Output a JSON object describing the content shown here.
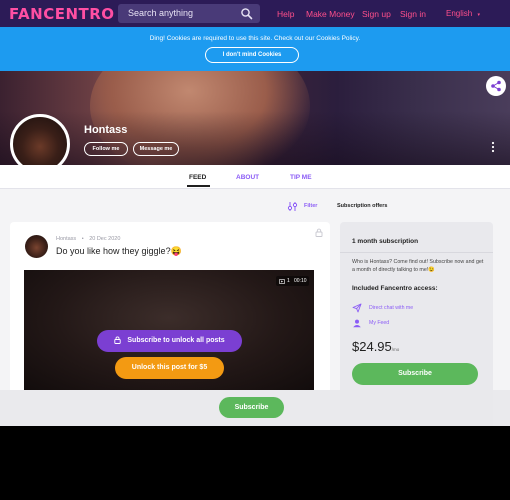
{
  "nav": {
    "logo_text": "FANCENTRO",
    "search_placeholder": "Search anything",
    "links": [
      "Help",
      "Make Money",
      "Sign up",
      "Sign in"
    ],
    "language": "English",
    "colors": {
      "bg": "#2c1b57",
      "link": "#ff4f8b",
      "logo": "#ff4fa3"
    }
  },
  "cookie_bar": {
    "message": "Ding! Cookies are required to use this site. Check out our Cookies Policy.",
    "button_label": "I don't mind Cookies",
    "color": "#1d9bf0"
  },
  "profile": {
    "name": "Hontass",
    "follow_label": "Follow me",
    "message_label": "Message me"
  },
  "tabs": [
    {
      "label": "FEED",
      "active": true
    },
    {
      "label": "ABOUT",
      "active": false
    },
    {
      "label": "TIP ME",
      "active": false
    }
  ],
  "filter": {
    "filter_label": "Filter",
    "subscription_offers_label": "Subscription offers"
  },
  "post": {
    "author": "Hontass",
    "separator": "•",
    "date": "20 Dec 2020",
    "title": "Do you like how they giggle?😝",
    "media_count": "1",
    "media_duration": "00:10",
    "unlock_all_label": "Subscribe to unlock all posts",
    "unlock_post_label": "Unlock this post for $5"
  },
  "subscription": {
    "title": "1 month subscription",
    "description": "Who is Hontass? Come find out! Subscribe now and get a month of directly talking to me!😉",
    "included_title": "Included Fancentro access:",
    "access_items": [
      {
        "icon": "send-icon",
        "label": "Direct chat with me"
      },
      {
        "icon": "feed-icon",
        "label": "My Feed"
      }
    ],
    "price": "$24.95",
    "price_period": "/mo",
    "subscribe_label": "Subscribe",
    "accent_color": "#8b5cf6",
    "button_color": "#5cb85c"
  },
  "sticky_bar": {
    "subscribe_label": "Subscribe"
  }
}
